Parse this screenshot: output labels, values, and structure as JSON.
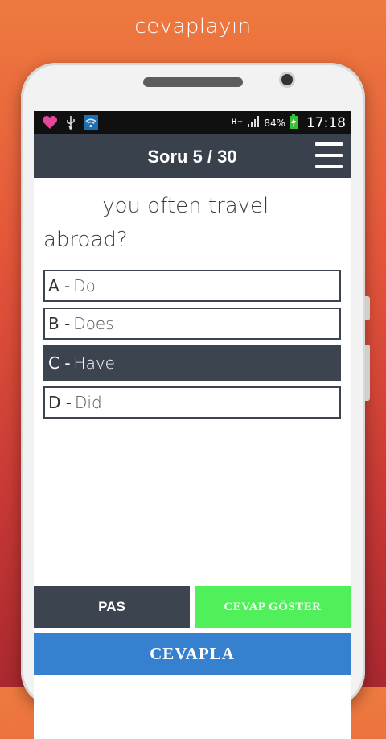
{
  "promo": {
    "title": "cevaplayın"
  },
  "statusbar": {
    "icons": [
      "heart-icon",
      "usb-icon",
      "wifi-icon"
    ],
    "network": "H+",
    "battery": "84%",
    "time": "17:18"
  },
  "appbar": {
    "title": "Soru 5 / 30",
    "menu_icon": "hamburger-icon"
  },
  "question": {
    "text": "_____ you often travel abroad?"
  },
  "options": [
    {
      "letter": "A -",
      "text": "Do",
      "selected": false
    },
    {
      "letter": "B -",
      "text": "Does",
      "selected": false
    },
    {
      "letter": "C -",
      "text": "Have",
      "selected": true
    },
    {
      "letter": "D -",
      "text": "Did",
      "selected": false
    }
  ],
  "actions": {
    "pass_label": "PAS",
    "show_answer_label": "CEVAP GÖSTER",
    "answer_label": "CEVAPLA"
  },
  "colors": {
    "appbar": "#39414c",
    "show_answer": "#4ff05a",
    "answer": "#3580cf",
    "selected_option": "#3c4450"
  }
}
